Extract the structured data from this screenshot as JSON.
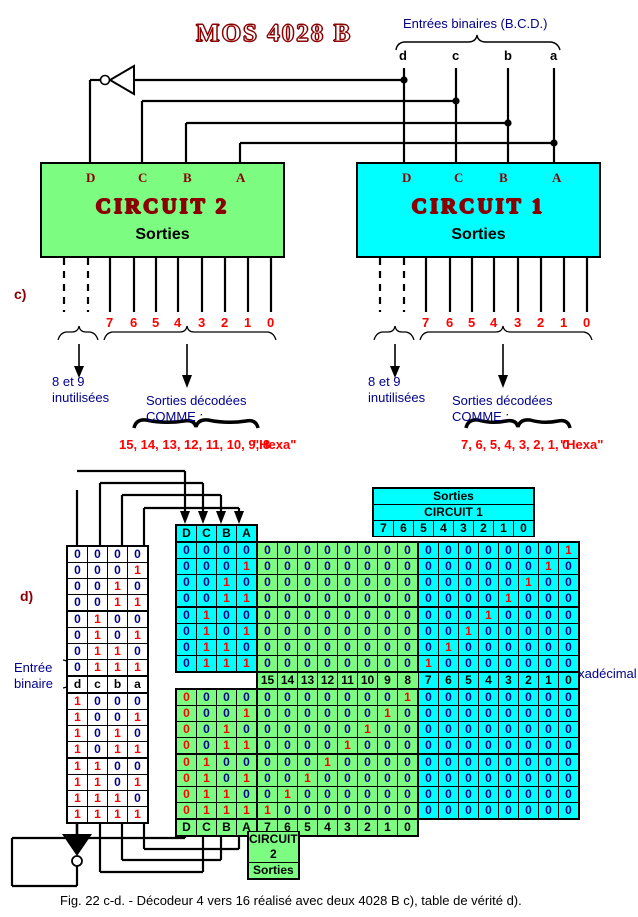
{
  "figure": {
    "title": "MOS 4028 B",
    "caption": "Fig. 22 c-d. - Décodeur 4 vers 16 réalisé avec deux 4028 B c), table de vérité d).",
    "part_c_label": "c)",
    "part_d_label": "d)"
  },
  "inputs": {
    "bracket_label": "Entrées binaires  (B.C.D.)",
    "pins": [
      "d",
      "c",
      "b",
      "a"
    ]
  },
  "chips": [
    {
      "id": "circuit2",
      "name": "CIRCUIT  2",
      "outputs_label": "Sorties",
      "color": "#7cfc80",
      "input_pins": [
        "D",
        "C",
        "B",
        "A"
      ],
      "output_pins": [
        "7",
        "6",
        "5",
        "4",
        "3",
        "2",
        "1",
        "0"
      ],
      "unused_note": "8 et 9\ninutilisées",
      "unused_note_line1": "8 et 9",
      "unused_note_line2": "inutilisées",
      "decoded_note_line1": "Sorties décodées",
      "decoded_note_line2": "COMME ;",
      "decoded_values": "15, 14, 13, 12, 11, 10, 9, 8",
      "hexa_label": "\"Hexa\""
    },
    {
      "id": "circuit1",
      "name": "CIRCUIT  1",
      "outputs_label": "Sorties",
      "color": "#00ffff",
      "input_pins": [
        "D",
        "C",
        "B",
        "A"
      ],
      "output_pins": [
        "7",
        "6",
        "5",
        "4",
        "3",
        "2",
        "1",
        "0"
      ],
      "unused_note_line1": "8 et 9",
      "unused_note_line2": "inutilisées",
      "decoded_note_line1": "Sorties décodées",
      "decoded_note_line2": "COMME ;",
      "decoded_values": "7, 6, 5, 4, 3, 2, 1, 0",
      "hexa_label": "\"Hexa\""
    }
  ],
  "truth_table": {
    "entree_binaire_line1": "Entrée",
    "entree_binaire_line2": "binaire",
    "chiffre_hexa_label": "Chiffre hexadécimal",
    "input_headers": [
      "d",
      "c",
      "b",
      "a"
    ],
    "input_headers_mid_row_index": 8,
    "input_rows": [
      [
        "0",
        "0",
        "0",
        "0"
      ],
      [
        "0",
        "0",
        "0",
        "1"
      ],
      [
        "0",
        "0",
        "1",
        "0"
      ],
      [
        "0",
        "0",
        "1",
        "1"
      ],
      [
        "0",
        "1",
        "0",
        "0"
      ],
      [
        "0",
        "1",
        "0",
        "1"
      ],
      [
        "0",
        "1",
        "1",
        "0"
      ],
      [
        "0",
        "1",
        "1",
        "1"
      ],
      [
        "1",
        "0",
        "0",
        "0"
      ],
      [
        "1",
        "0",
        "0",
        "1"
      ],
      [
        "1",
        "0",
        "1",
        "0"
      ],
      [
        "1",
        "0",
        "1",
        "1"
      ],
      [
        "1",
        "1",
        "0",
        "0"
      ],
      [
        "1",
        "1",
        "0",
        "1"
      ],
      [
        "1",
        "1",
        "1",
        "0"
      ],
      [
        "1",
        "1",
        "1",
        "1"
      ]
    ],
    "top_header": {
      "sorties": "Sorties",
      "circuit": "CIRCUIT  1",
      "columns": [
        "7",
        "6",
        "5",
        "4",
        "3",
        "2",
        "1",
        "0"
      ]
    },
    "bottom_header": {
      "sorties": "Sorties",
      "circuit": "CIRCUIT  2",
      "columns": [
        "7",
        "6",
        "5",
        "4",
        "3",
        "2",
        "1",
        "0"
      ]
    },
    "dcba_top": [
      "D",
      "C",
      "B",
      "A"
    ],
    "dcba_bottom": [
      "D",
      "C",
      "B",
      "A"
    ],
    "hex_row": [
      "15",
      "14",
      "13",
      "12",
      "11",
      "10",
      "9",
      "8",
      "7",
      "6",
      "5",
      "4",
      "3",
      "2",
      "1",
      "0"
    ],
    "dcba_rows": [
      [
        "0",
        "0",
        "0",
        "0"
      ],
      [
        "0",
        "0",
        "0",
        "1"
      ],
      [
        "0",
        "0",
        "1",
        "0"
      ],
      [
        "0",
        "0",
        "1",
        "1"
      ],
      [
        "0",
        "1",
        "0",
        "0"
      ],
      [
        "0",
        "1",
        "0",
        "1"
      ],
      [
        "0",
        "1",
        "1",
        "0"
      ],
      [
        "0",
        "1",
        "1",
        "1"
      ],
      [
        "0",
        "0",
        "0",
        "0"
      ],
      [
        "0",
        "0",
        "0",
        "1"
      ],
      [
        "0",
        "0",
        "1",
        "0"
      ],
      [
        "0",
        "0",
        "1",
        "1"
      ],
      [
        "0",
        "1",
        "0",
        "0"
      ],
      [
        "0",
        "1",
        "0",
        "1"
      ],
      [
        "0",
        "1",
        "1",
        "0"
      ],
      [
        "0",
        "1",
        "1",
        "1"
      ]
    ],
    "dcba_rows_d_red": [
      false,
      false,
      false,
      false,
      false,
      false,
      false,
      false,
      true,
      true,
      true,
      true,
      true,
      true,
      true,
      true
    ],
    "output_rows": [
      [
        "0",
        "0",
        "0",
        "0",
        "0",
        "0",
        "0",
        "0",
        "0",
        "0",
        "0",
        "0",
        "0",
        "0",
        "0",
        "1"
      ],
      [
        "0",
        "0",
        "0",
        "0",
        "0",
        "0",
        "0",
        "0",
        "0",
        "0",
        "0",
        "0",
        "0",
        "0",
        "1",
        "0"
      ],
      [
        "0",
        "0",
        "0",
        "0",
        "0",
        "0",
        "0",
        "0",
        "0",
        "0",
        "0",
        "0",
        "0",
        "1",
        "0",
        "0"
      ],
      [
        "0",
        "0",
        "0",
        "0",
        "0",
        "0",
        "0",
        "0",
        "0",
        "0",
        "0",
        "0",
        "1",
        "0",
        "0",
        "0"
      ],
      [
        "0",
        "0",
        "0",
        "0",
        "0",
        "0",
        "0",
        "0",
        "0",
        "0",
        "0",
        "1",
        "0",
        "0",
        "0",
        "0"
      ],
      [
        "0",
        "0",
        "0",
        "0",
        "0",
        "0",
        "0",
        "0",
        "0",
        "0",
        "1",
        "0",
        "0",
        "0",
        "0",
        "0"
      ],
      [
        "0",
        "0",
        "0",
        "0",
        "0",
        "0",
        "0",
        "0",
        "0",
        "1",
        "0",
        "0",
        "0",
        "0",
        "0",
        "0"
      ],
      [
        "0",
        "0",
        "0",
        "0",
        "0",
        "0",
        "0",
        "0",
        "1",
        "0",
        "0",
        "0",
        "0",
        "0",
        "0",
        "0"
      ],
      [
        "0",
        "0",
        "0",
        "0",
        "0",
        "0",
        "0",
        "1",
        "0",
        "0",
        "0",
        "0",
        "0",
        "0",
        "0",
        "0"
      ],
      [
        "0",
        "0",
        "0",
        "0",
        "0",
        "0",
        "1",
        "0",
        "0",
        "0",
        "0",
        "0",
        "0",
        "0",
        "0",
        "0"
      ],
      [
        "0",
        "0",
        "0",
        "0",
        "0",
        "1",
        "0",
        "0",
        "0",
        "0",
        "0",
        "0",
        "0",
        "0",
        "0",
        "0"
      ],
      [
        "0",
        "0",
        "0",
        "0",
        "1",
        "0",
        "0",
        "0",
        "0",
        "0",
        "0",
        "0",
        "0",
        "0",
        "0",
        "0"
      ],
      [
        "0",
        "0",
        "0",
        "1",
        "0",
        "0",
        "0",
        "0",
        "0",
        "0",
        "0",
        "0",
        "0",
        "0",
        "0",
        "0"
      ],
      [
        "0",
        "0",
        "1",
        "0",
        "0",
        "0",
        "0",
        "0",
        "0",
        "0",
        "0",
        "0",
        "0",
        "0",
        "0",
        "0"
      ],
      [
        "0",
        "1",
        "0",
        "0",
        "0",
        "0",
        "0",
        "0",
        "0",
        "0",
        "0",
        "0",
        "0",
        "0",
        "0",
        "0"
      ],
      [
        "1",
        "0",
        "0",
        "0",
        "0",
        "0",
        "0",
        "0",
        "0",
        "0",
        "0",
        "0",
        "0",
        "0",
        "0",
        "0"
      ]
    ]
  },
  "colors": {
    "circuit2_bg": "#7cfc80",
    "circuit1_bg": "#00ffff",
    "label_blue": "#00008b",
    "label_red": "#ff0000",
    "title_red": "#8b0000"
  }
}
